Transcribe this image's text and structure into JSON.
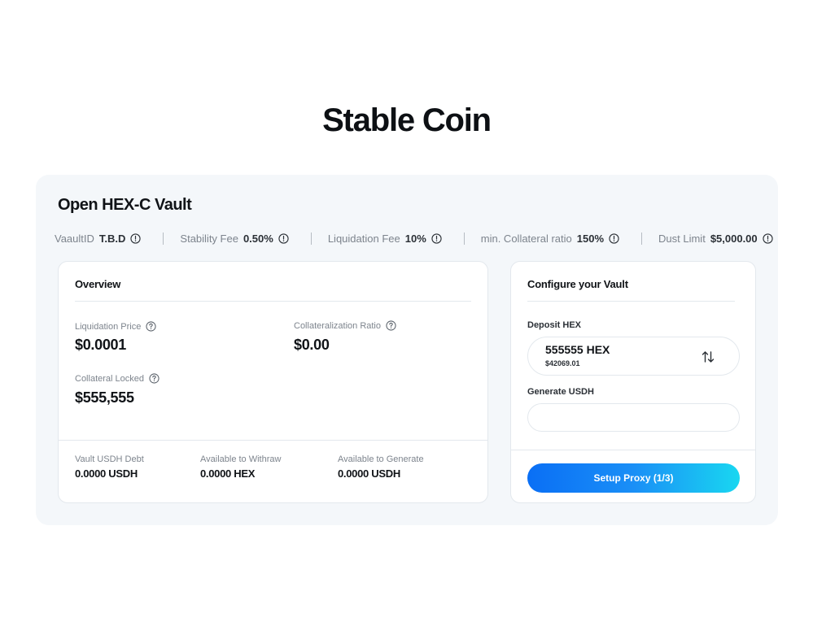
{
  "page": {
    "title": "Stable Coin"
  },
  "vault": {
    "title": "Open HEX-C Vault",
    "params": [
      {
        "label": "VaaultID",
        "value": "T.B.D"
      },
      {
        "label": "Stability Fee",
        "value": "0.50%"
      },
      {
        "label": "Liquidation Fee",
        "value": "10%"
      },
      {
        "label": "min. Collateral ratio",
        "value": "150%"
      },
      {
        "label": "Dust Limit",
        "value": "$5,000.00"
      }
    ]
  },
  "overview": {
    "title": "Overview",
    "liquidation_price": {
      "label": "Liquidation Price",
      "value": "$0.0001"
    },
    "collateralization_ratio": {
      "label": "Collateralization Ratio",
      "value": "$0.00"
    },
    "collateral_locked": {
      "label": "Collateral Locked",
      "value": "$555,555"
    },
    "footer": [
      {
        "label": "Vault USDH Debt",
        "value": "0.0000 USDH"
      },
      {
        "label": "Available to Withraw",
        "value": "0.0000 HEX"
      },
      {
        "label": "Available to Generate",
        "value": "0.0000 USDH"
      }
    ]
  },
  "configure": {
    "title": "Configure your Vault",
    "deposit_label": "Deposit HEX",
    "deposit_amount": "555555 HEX",
    "deposit_usd": "$42069.01",
    "generate_label": "Generate USDH",
    "generate_value": "",
    "button_label": "Setup Proxy (1/3)"
  },
  "icons": {
    "info": "info-circle-icon",
    "help": "question-circle-icon",
    "swap": "swap-arrows-icon"
  },
  "colors": {
    "panel_bg": "#f4f7fa",
    "button_gradient_start": "#0a6ff5",
    "button_gradient_end": "#19d7f1"
  }
}
